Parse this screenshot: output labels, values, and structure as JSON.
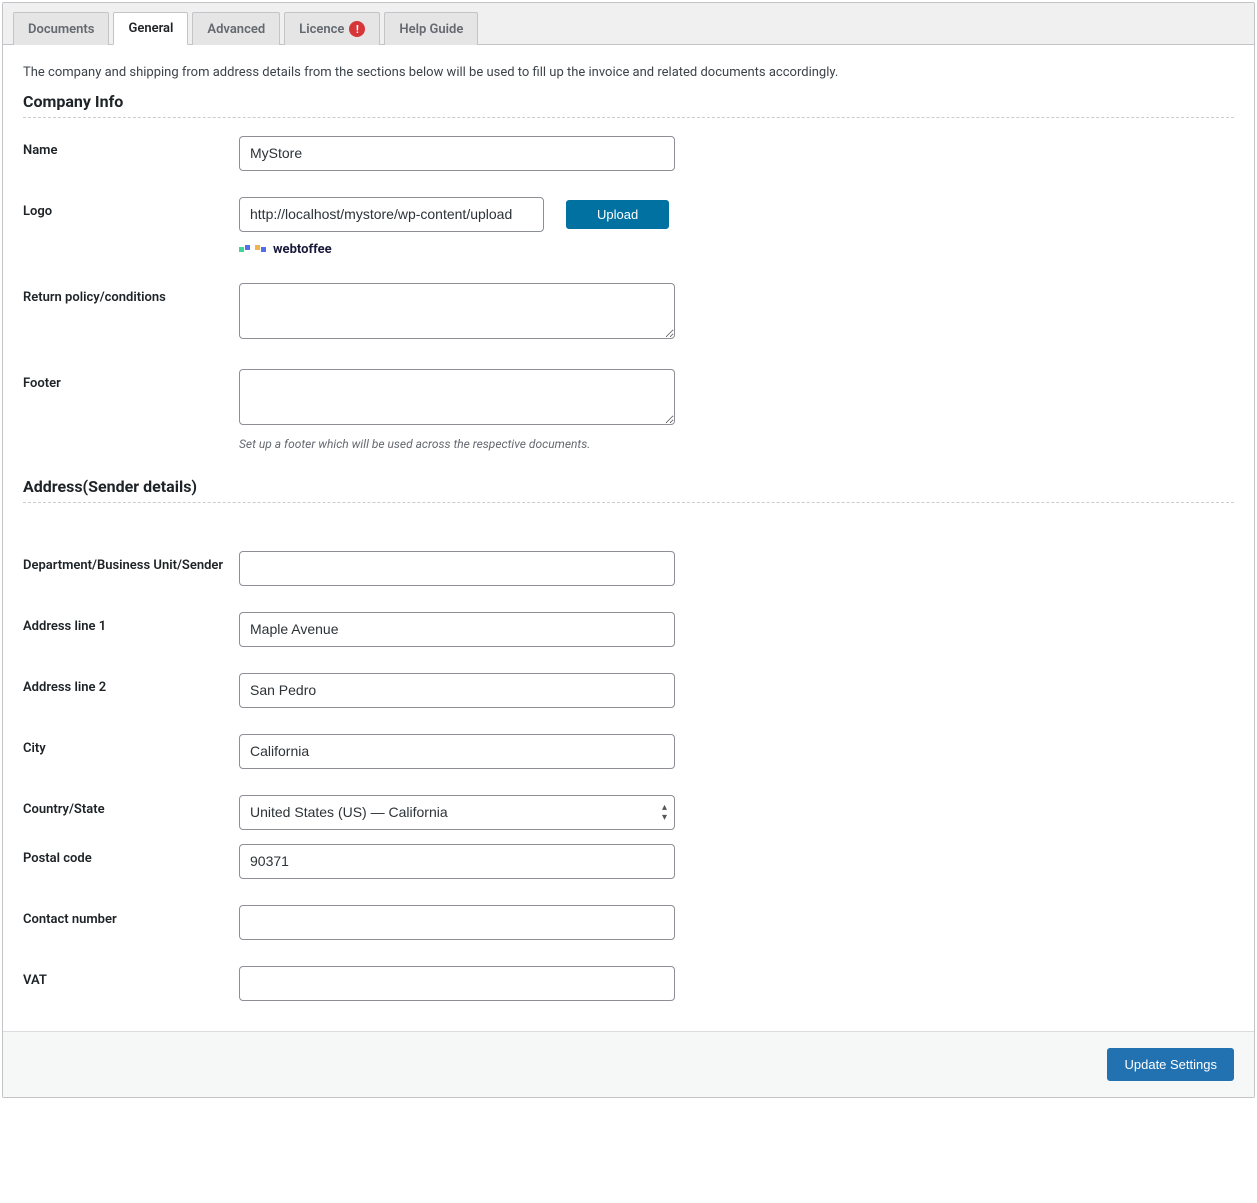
{
  "tabs": [
    {
      "label": "Documents"
    },
    {
      "label": "General"
    },
    {
      "label": "Advanced"
    },
    {
      "label": "Licence",
      "alert": "!"
    },
    {
      "label": "Help Guide"
    }
  ],
  "intro": "The company and shipping from address details from the sections below will be used to fill up the invoice and related documents accordingly.",
  "sections": {
    "company": {
      "title": "Company Info"
    },
    "address": {
      "title": "Address(Sender details)"
    }
  },
  "fields": {
    "name": {
      "label": "Name",
      "value": "MyStore"
    },
    "logo": {
      "label": "Logo",
      "value": "http://localhost/mystore/wp-content/upload",
      "upload_btn": "Upload",
      "preview_text": "webtoffee"
    },
    "return_policy": {
      "label": "Return policy/conditions",
      "value": ""
    },
    "footer": {
      "label": "Footer",
      "value": "",
      "help": "Set up a footer which will be used across the respective documents."
    },
    "department": {
      "label": "Department/Business Unit/Sender",
      "value": ""
    },
    "address1": {
      "label": "Address line 1",
      "value": "Maple Avenue"
    },
    "address2": {
      "label": "Address line 2",
      "value": "San Pedro"
    },
    "city": {
      "label": "City",
      "value": "California"
    },
    "country": {
      "label": "Country/State",
      "value": "United States (US) — California"
    },
    "postal": {
      "label": "Postal code",
      "value": "90371"
    },
    "contact": {
      "label": "Contact number",
      "value": ""
    },
    "vat": {
      "label": "VAT",
      "value": ""
    }
  },
  "actions": {
    "update": "Update Settings"
  }
}
